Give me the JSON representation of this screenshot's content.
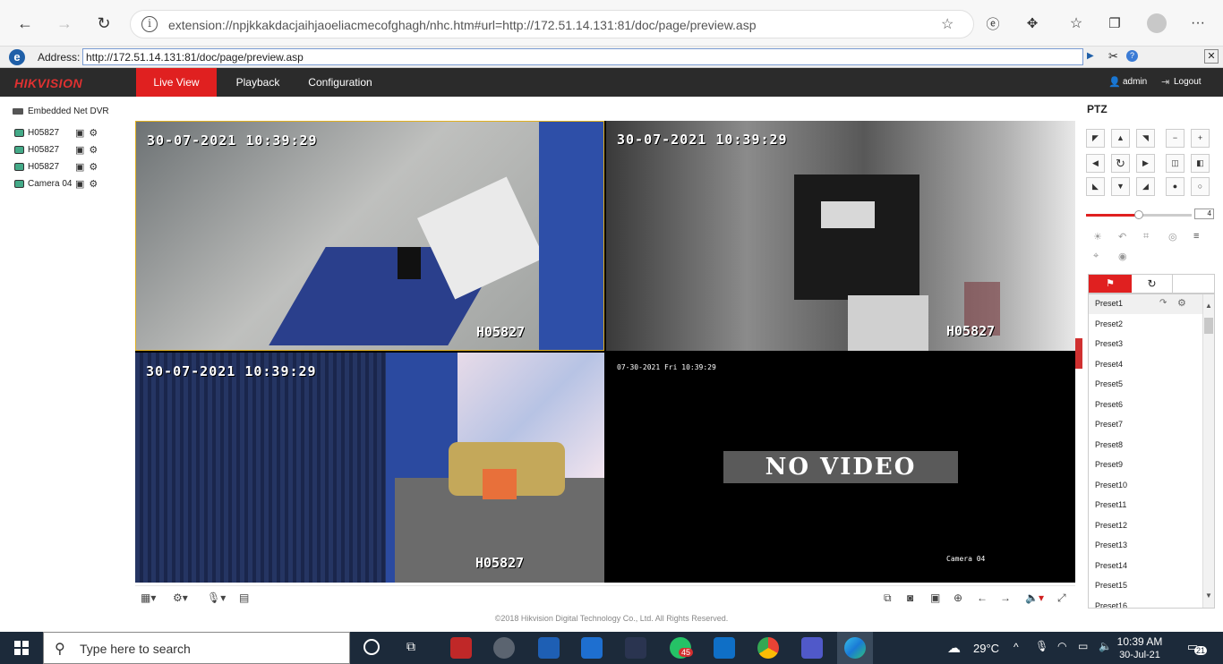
{
  "browser": {
    "url": "extension://npjkkakdacjaihjaoeliacmecofghagh/nhc.htm#url=http://172.51.14.131:81/doc/page/preview.asp",
    "ie_address_label": "Address:",
    "ie_address_value": "http://172.51.14.131:81/doc/page/preview.asp"
  },
  "nav": {
    "logo": "HIKVISION",
    "tabs": [
      "Live View",
      "Playback",
      "Configuration"
    ],
    "user": "admin",
    "logout": "Logout"
  },
  "tree": {
    "root": "Embedded Net DVR",
    "cameras": [
      "H05827",
      "H05827",
      "H05827",
      "Camera 04"
    ]
  },
  "tiles": [
    {
      "osd": "30-07-2021 10:39:29",
      "name": "H05827"
    },
    {
      "osd": "30-07-2021 10:39:29",
      "name": "H05827"
    },
    {
      "osd": "30-07-2021 10:39:29",
      "name": "H05827"
    },
    {
      "osd": "07-30-2021 Fri 10:39:29",
      "name": "Camera 04",
      "no_video": "NO VIDEO"
    }
  ],
  "footer": "©2018 Hikvision Digital Technology Co., Ltd. All Rights Reserved.",
  "ptz": {
    "title": "PTZ",
    "speed": "4",
    "speed_level": 0.5,
    "presets": [
      "Preset1",
      "Preset2",
      "Preset3",
      "Preset4",
      "Preset5",
      "Preset6",
      "Preset7",
      "Preset8",
      "Preset9",
      "Preset10",
      "Preset11",
      "Preset12",
      "Preset13",
      "Preset14",
      "Preset15",
      "Preset16"
    ]
  },
  "taskbar": {
    "search_placeholder": "Type here to search",
    "weather": "29°C",
    "time": "10:39 AM",
    "date": "30-Jul-21",
    "notifications": "21",
    "whatsapp_badge": "45"
  },
  "colors": {
    "accent": "#e02020",
    "nav_bg": "#2b2b2b",
    "taskbar": "#1c2a3a"
  }
}
